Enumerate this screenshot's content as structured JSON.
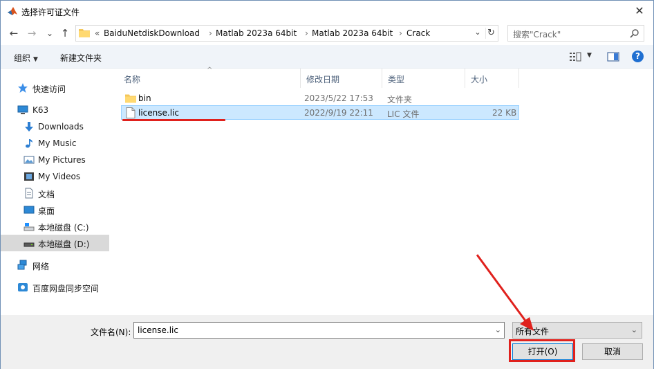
{
  "window": {
    "title": "选择许可证文件",
    "close_glyph": "✕"
  },
  "nav_buttons": {
    "back": "←",
    "forward": "→",
    "recent": "⌄",
    "up": "↑"
  },
  "address": {
    "overflow": "«",
    "crumbs": [
      "BaiduNetdiskDownload",
      "Matlab 2023a 64bit",
      "Matlab 2023a 64bit",
      "Crack"
    ],
    "separator": "›",
    "dropdown_glyph": "⌄",
    "refresh_glyph": "↻"
  },
  "search": {
    "placeholder": "搜索\"Crack\""
  },
  "toolbar": {
    "organize_label": "组织",
    "organize_caret": "▼",
    "new_folder_label": "新建文件夹",
    "view_caret": "▼",
    "help_glyph": "?"
  },
  "sidebar": {
    "items": [
      {
        "label": "快速访问",
        "icon": "quick-access-star-icon"
      },
      {
        "label": "K63",
        "icon": "computer-icon"
      },
      {
        "label": "Downloads",
        "icon": "downloads-icon"
      },
      {
        "label": "My Music",
        "icon": "music-icon"
      },
      {
        "label": "My Pictures",
        "icon": "pictures-icon"
      },
      {
        "label": "My Videos",
        "icon": "videos-icon"
      },
      {
        "label": "文档",
        "icon": "documents-icon"
      },
      {
        "label": "桌面",
        "icon": "desktop-icon"
      },
      {
        "label": "本地磁盘 (C:)",
        "icon": "drive-c-icon"
      },
      {
        "label": "本地磁盘 (D:)",
        "icon": "drive-d-icon",
        "selected": true
      },
      {
        "label": "网络",
        "icon": "network-icon"
      },
      {
        "label": "百度网盘同步空间",
        "icon": "baidu-sync-icon"
      }
    ]
  },
  "file_list": {
    "sort_glyph": "^",
    "columns": [
      "名称",
      "修改日期",
      "类型",
      "大小"
    ],
    "rows": [
      {
        "name": "bin",
        "date": "2023/5/22 17:53",
        "type": "文件夹",
        "size": "",
        "kind": "folder"
      },
      {
        "name": "license.lic",
        "date": "2022/9/19 22:11",
        "type": "LIC 文件",
        "size": "22 KB",
        "kind": "file",
        "selected": true
      }
    ]
  },
  "footer": {
    "filename_label": "文件名(N):",
    "filename_value": "license.lic",
    "filename_drop": "⌄",
    "filetype_value": "所有文件",
    "filetype_drop": "⌄",
    "open_label": "打开(O)",
    "cancel_label": "取消"
  },
  "colors": {
    "accent": "#0078d7",
    "selection_bg": "#cce8ff",
    "annotation_red": "#e0211d",
    "toolbar_bg": "#f0f4f9"
  }
}
